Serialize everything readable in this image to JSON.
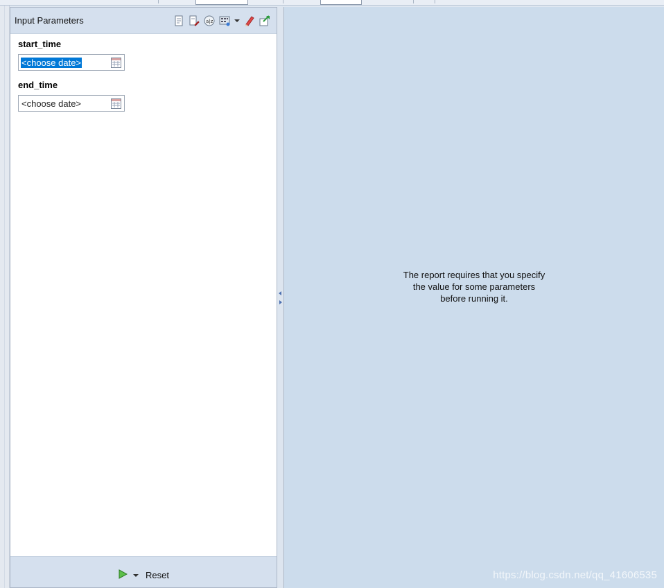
{
  "panel": {
    "title": "Input Parameters",
    "toolbar": [
      "new-parameter-icon",
      "edit-parameter-icon",
      "sort-az-icon",
      "layout-grid-icon",
      "view-menu-icon",
      "clear-icon",
      "apply-icon"
    ]
  },
  "parameters": [
    {
      "label": "start_time",
      "value": "<choose date>",
      "selected": true
    },
    {
      "label": "end_time",
      "value": "<choose date>",
      "selected": false
    }
  ],
  "footer": {
    "run_icon": "run-icon",
    "reset_label": "Reset"
  },
  "report": {
    "message_lines": [
      "The report requires that you specify",
      "the value for some parameters",
      "before running it."
    ]
  },
  "watermark": "https://blog.csdn.net/qq_41606535",
  "colors": {
    "selection": "#0078d7",
    "report_bg": "#ccdcec",
    "header_bg": "#d5e0ee"
  }
}
